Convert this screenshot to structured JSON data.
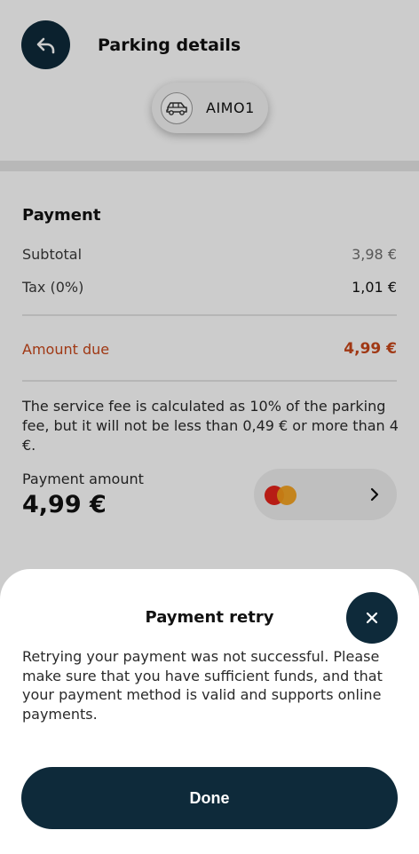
{
  "header": {
    "title": "Parking details",
    "back_icon": "back-arrow-icon",
    "vehicle": {
      "icon": "car-icon",
      "plate": "AIMO1"
    }
  },
  "payment": {
    "title": "Payment",
    "subtotal_label": "Subtotal",
    "subtotal_value": "3,98 €",
    "tax_label": "Tax (0%)",
    "tax_value": "1,01 €",
    "amount_due_label": "Amount due",
    "amount_due_value": "4,99 €",
    "fee_note": "The service fee is calculated as 10% of the parking fee, but it will not be less than 0,49 € or more than 4 €.",
    "payment_amount_label": "Payment amount",
    "payment_amount_value": "4,99 €",
    "method_icon": "mastercard-icon"
  },
  "sheet": {
    "title": "Payment retry",
    "close_icon": "close-icon",
    "message": "Retrying your payment was not successful. Please make sure that you have sufficient funds, and that your payment method is valid and supports online payments.",
    "done_label": "Done"
  },
  "colors": {
    "primary_dark": "#0e2a3a",
    "accent_due": "#c8471a",
    "overlay": "rgba(0,0,0,0.20)"
  }
}
